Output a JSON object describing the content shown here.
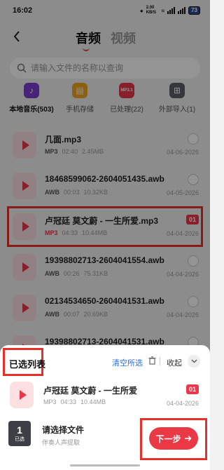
{
  "status_bar": {
    "time": "16:02",
    "network_speed": "2.00 KB/S",
    "battery": "73"
  },
  "header": {
    "tab_audio": "音频",
    "tab_video": "视频"
  },
  "search": {
    "placeholder": "请输入文件的名称以查询"
  },
  "categories": [
    {
      "label": "本地音乐(503)",
      "icon": "music-note-icon",
      "color": "#7b3fcf"
    },
    {
      "label": "手机存储",
      "icon": "phone-storage-icon",
      "color": "#f2a51f"
    },
    {
      "label": "已处理(22)",
      "icon": "mp3-processed-icon",
      "color": "#e8384a",
      "icon_text": "MP3.1"
    },
    {
      "label": "外部导入(1)",
      "icon": "external-import-icon",
      "color": "#5a5f66"
    }
  ],
  "files": [
    {
      "name": "几面.mp3",
      "type": "MP3",
      "duration": "02:40",
      "size": "2.45MB",
      "date": "04-06-2026"
    },
    {
      "name": "18468599062-2604051435.awb",
      "type": "AWB",
      "duration": "00:03",
      "size": "10.32KB",
      "date": "04-05-2026"
    },
    {
      "name": "卢冠廷 莫文蔚 - 一生所爱.mp3",
      "type": "MP3",
      "duration": "04:33",
      "size": "10.44MB",
      "date": "04-04-2026",
      "badge": "01"
    },
    {
      "name": "19398802713-2604041554.awb",
      "type": "AWB",
      "duration": "00:26",
      "size": "75.31KB",
      "date": "04-04-2026"
    },
    {
      "name": "02134534650-2604041531.awb",
      "type": "AWB",
      "duration": "00:07",
      "size": "20.69KB",
      "date": "04-04-2026"
    },
    {
      "name": "19398802713-2604041531.awb",
      "type": "AWB",
      "duration": "",
      "size": "",
      "date": ""
    }
  ],
  "sheet": {
    "title": "已选列表",
    "clear_label": "清空所选",
    "collapse_label": "收起",
    "selected_item": {
      "name": "卢冠廷 莫文蔚 - 一生所爱",
      "type": "MP3",
      "duration": "04:33",
      "size": "10.44MB",
      "date": "04-04-2026",
      "badge": "01"
    }
  },
  "footer": {
    "count": "1",
    "count_label": "已选",
    "title": "请选择文件",
    "subtitle": "伴奏人声提取",
    "next_label": "下一步"
  },
  "colors": {
    "accent": "#e8384a",
    "link": "#2f6cd8",
    "highlight_frame": "#e8302a"
  }
}
